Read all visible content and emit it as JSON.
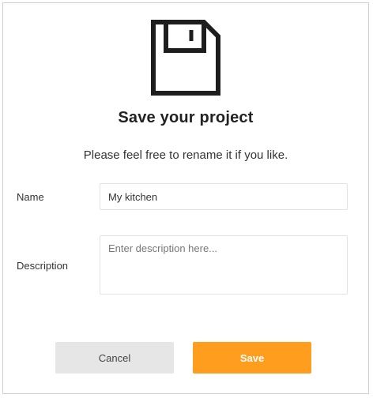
{
  "dialog": {
    "icon": "floppy-disk-icon",
    "title": "Save your project",
    "subtitle": "Please feel free to rename it if you like."
  },
  "form": {
    "name_label": "Name",
    "name_value": "My kitchen",
    "description_label": "Description",
    "description_value": "",
    "description_placeholder": "Enter description here..."
  },
  "buttons": {
    "cancel_label": "Cancel",
    "save_label": "Save"
  },
  "colors": {
    "accent": "#ff9d1f",
    "cancel_bg": "#e6e6e6",
    "border": "#cfcfcf"
  }
}
